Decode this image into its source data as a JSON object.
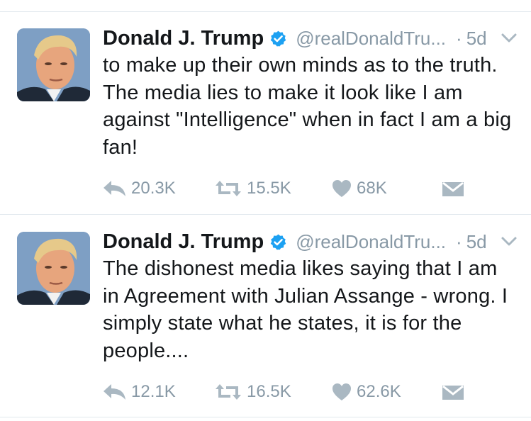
{
  "tweets": [
    {
      "name": "Donald J. Trump",
      "handle": "@realDonaldTru...",
      "separator": "·",
      "time": "5d",
      "text": "to make up their own minds as to the truth. The media lies to make it look like I am against \"Intelligence\" when in fact I am a big fan!",
      "replies": "20.3K",
      "retweets": "15.5K",
      "likes": "68K"
    },
    {
      "name": "Donald J. Trump",
      "handle": "@realDonaldTru...",
      "separator": "·",
      "time": "5d",
      "text": "The dishonest media likes saying that I am in Agreement with Julian Assange - wrong. I simply state what he states, it is for the people....",
      "replies": "12.1K",
      "retweets": "16.5K",
      "likes": "62.6K"
    }
  ],
  "icons": {
    "verified": "verified-badge-icon",
    "caret": "chevron-down-icon",
    "reply": "reply-icon",
    "retweet": "retweet-icon",
    "like": "heart-icon",
    "dm": "direct-message-icon"
  },
  "colors": {
    "text": "#14171a",
    "secondary": "#8899a6",
    "verified": "#1da1f2",
    "action_icon": "#aab8c2",
    "divider": "#e1e8ed"
  }
}
